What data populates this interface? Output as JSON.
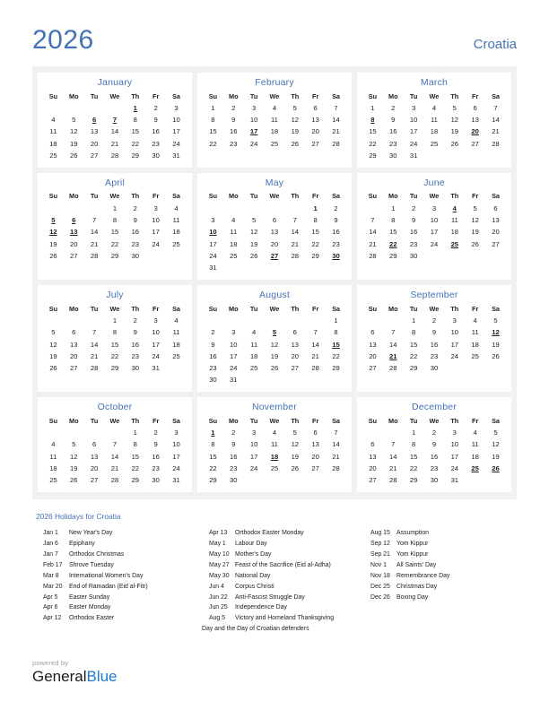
{
  "header": {
    "year": "2026",
    "country": "Croatia"
  },
  "weekdays": [
    "Su",
    "Mo",
    "Tu",
    "We",
    "Th",
    "Fr",
    "Sa"
  ],
  "colors": {
    "accent_blue": "#4472b8",
    "holiday_red": "#e00000",
    "panel_gray": "#f1f1f1",
    "brand_blue": "#1a79d0"
  },
  "months": [
    {
      "name": "January",
      "start": 4,
      "days": 31,
      "holidays": [
        1,
        6,
        7
      ],
      "plain_holidays": []
    },
    {
      "name": "February",
      "start": 0,
      "days": 28,
      "holidays": [
        17
      ],
      "plain_holidays": []
    },
    {
      "name": "March",
      "start": 0,
      "days": 31,
      "holidays": [
        8,
        20
      ],
      "plain_holidays": []
    },
    {
      "name": "April",
      "start": 3,
      "days": 30,
      "holidays": [
        5,
        6,
        12,
        13
      ],
      "plain_holidays": []
    },
    {
      "name": "May",
      "start": 5,
      "days": 31,
      "holidays": [
        10,
        27,
        30
      ],
      "plain_holidays": [
        1
      ]
    },
    {
      "name": "June",
      "start": 1,
      "days": 30,
      "holidays": [
        4,
        22,
        25
      ],
      "plain_holidays": []
    },
    {
      "name": "July",
      "start": 3,
      "days": 31,
      "holidays": [],
      "plain_holidays": []
    },
    {
      "name": "August",
      "start": 6,
      "days": 31,
      "holidays": [
        5,
        15
      ],
      "plain_holidays": []
    },
    {
      "name": "September",
      "start": 2,
      "days": 30,
      "holidays": [
        12,
        21
      ],
      "plain_holidays": []
    },
    {
      "name": "October",
      "start": 4,
      "days": 31,
      "holidays": [],
      "plain_holidays": []
    },
    {
      "name": "November",
      "start": 0,
      "days": 30,
      "holidays": [
        1,
        18
      ],
      "plain_holidays": []
    },
    {
      "name": "December",
      "start": 2,
      "days": 31,
      "holidays": [
        25,
        26
      ],
      "plain_holidays": []
    }
  ],
  "holidays_section": {
    "title": "2026 Holidays for Croatia",
    "columns": [
      [
        {
          "date": "Jan 1",
          "name": "New Year's Day"
        },
        {
          "date": "Jan 6",
          "name": "Epiphany"
        },
        {
          "date": "Jan 7",
          "name": "Orthodox Christmas"
        },
        {
          "date": "Feb 17",
          "name": "Shrove Tuesday"
        },
        {
          "date": "Mar 8",
          "name": "International Women's Day"
        },
        {
          "date": "Mar 20",
          "name": "End of Ramadan (Eid al-Fitr)"
        },
        {
          "date": "Apr 5",
          "name": "Easter Sunday"
        },
        {
          "date": "Apr 6",
          "name": "Easter Monday"
        },
        {
          "date": "Apr 12",
          "name": "Orthodox Easter"
        }
      ],
      [
        {
          "date": "Apr 13",
          "name": "Orthodox Easter Monday"
        },
        {
          "date": "May 1",
          "name": "Labour Day"
        },
        {
          "date": "May 10",
          "name": "Mother's Day"
        },
        {
          "date": "May 27",
          "name": "Feast of the Sacrifice (Eid al-Adha)"
        },
        {
          "date": "May 30",
          "name": "National Day"
        },
        {
          "date": "Jun 4",
          "name": "Corpus Christi"
        },
        {
          "date": "Jun 22",
          "name": "Anti-Fascist Struggle Day"
        },
        {
          "date": "Jun 25",
          "name": "Independence Day"
        },
        {
          "date": "Aug 5",
          "name": "Victory and Homeland Thanksgiving",
          "continuation": "Day and the Day of Croatian defenders"
        }
      ],
      [
        {
          "date": "Aug 15",
          "name": "Assumption"
        },
        {
          "date": "Sep 12",
          "name": "Yom Kippur"
        },
        {
          "date": "Sep 21",
          "name": "Yom Kippur"
        },
        {
          "date": "Nov 1",
          "name": "All Saints' Day"
        },
        {
          "date": "Nov 18",
          "name": "Remembrance Day"
        },
        {
          "date": "Dec 25",
          "name": "Christmas Day"
        },
        {
          "date": "Dec 26",
          "name": "Boxing Day"
        }
      ]
    ]
  },
  "footer": {
    "powered_by": "powered by",
    "brand_first": "General",
    "brand_second": "Blue"
  }
}
